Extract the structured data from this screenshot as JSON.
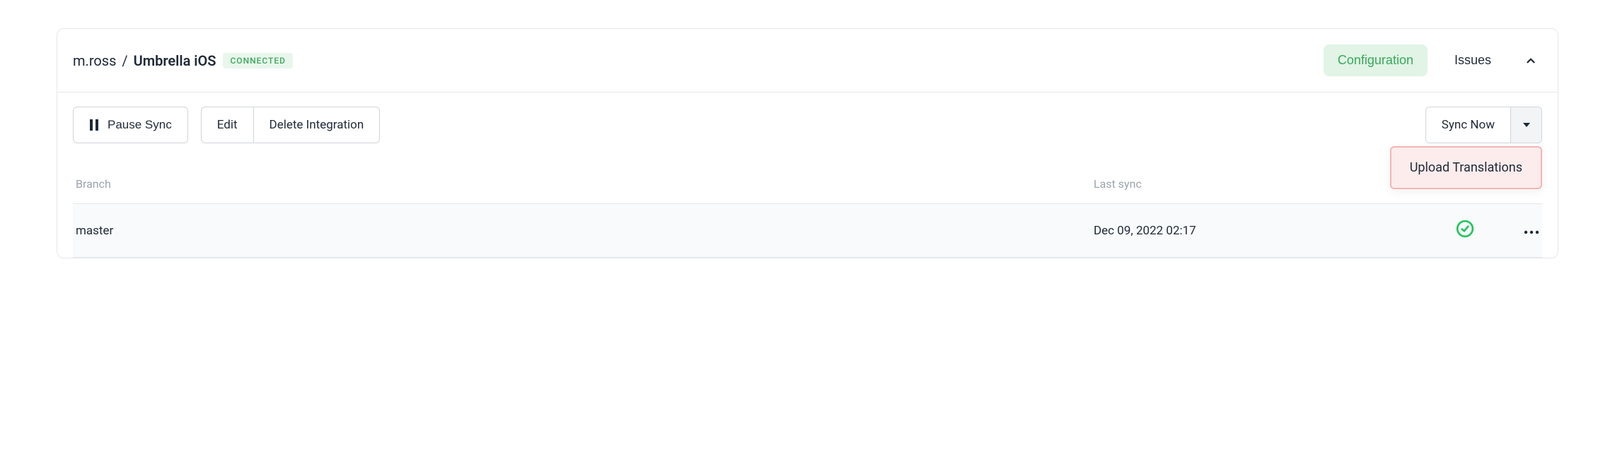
{
  "header": {
    "owner": "m.ross",
    "project": "Umbrella iOS",
    "status": "CONNECTED",
    "tabs": {
      "configuration": "Configuration",
      "issues": "Issues"
    }
  },
  "toolbar": {
    "pause_sync": "Pause Sync",
    "edit": "Edit",
    "delete_integration": "Delete Integration",
    "sync_now": "Sync Now"
  },
  "dropdown": {
    "upload_translations": "Upload Translations"
  },
  "table": {
    "headers": {
      "branch": "Branch",
      "last_sync": "Last sync"
    },
    "rows": [
      {
        "branch": "master",
        "last_sync": "Dec 09, 2022 02:17"
      }
    ]
  }
}
